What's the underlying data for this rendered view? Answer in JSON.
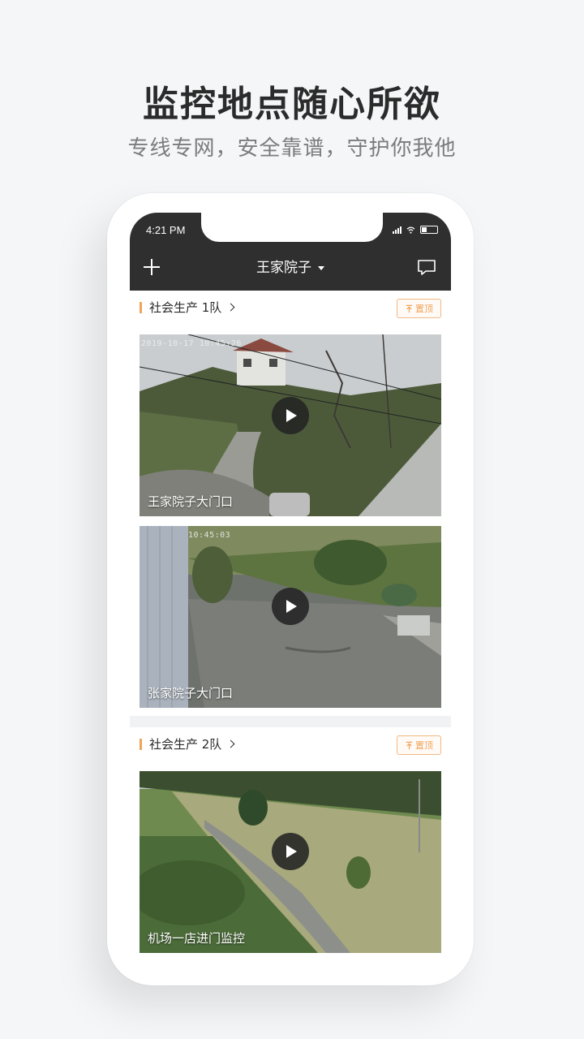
{
  "promo": {
    "title": "监控地点随心所欲",
    "subtitle": "专线专网，安全靠谱，守护你我他"
  },
  "status_bar": {
    "time": "4:21 PM"
  },
  "nav": {
    "title": "王家院子",
    "icons": [
      "plus-icon",
      "chevron-down-icon",
      "message-icon"
    ]
  },
  "sections": [
    {
      "name": "社会生产 1队",
      "pin_label": "置顶",
      "cameras": [
        {
          "label": "王家院子大门口",
          "timestamp": "2019-10-17  10:45:26"
        },
        {
          "label": "张家院子大门口",
          "timestamp": "10:45:03"
        }
      ]
    },
    {
      "name": "社会生产 2队",
      "pin_label": "置顶",
      "cameras": [
        {
          "label": "机场一店进门监控",
          "timestamp": ""
        }
      ]
    }
  ],
  "colors": {
    "accent": "#f0a35a",
    "nav_bg": "#2f2f2f",
    "page_bg": "#f5f6f8"
  }
}
